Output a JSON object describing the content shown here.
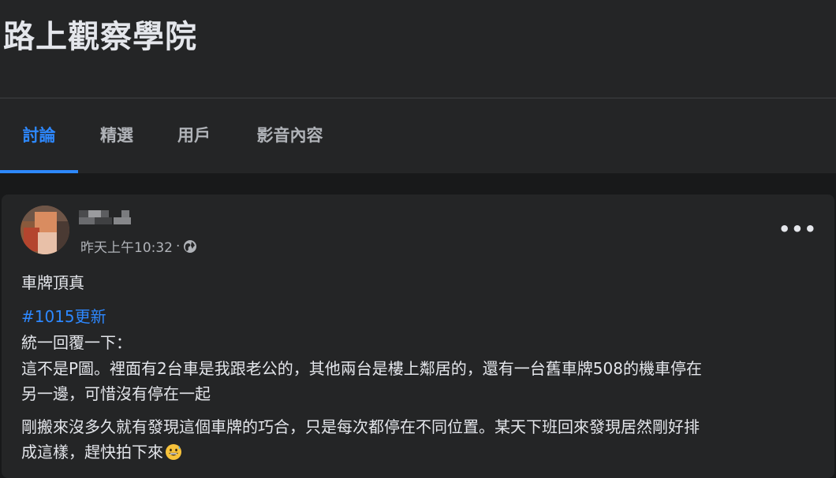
{
  "group": {
    "title": "路上觀察學院"
  },
  "tabs": [
    {
      "label": "討論",
      "active": true
    },
    {
      "label": "精選",
      "active": false
    },
    {
      "label": "用戶",
      "active": false
    },
    {
      "label": "影音內容",
      "active": false
    }
  ],
  "post": {
    "timestamp": "昨天上午10:32",
    "dot": "·",
    "visibility_icon": "globe-icon",
    "more_label": "•••",
    "title": "車牌頂真",
    "hashtag": "#1015更新",
    "body": [
      "統一回覆一下：",
      "這不是P圖。裡面有2台車是我跟老公的，其他兩台是樓上鄰居的，還有一台舊車牌508的機車停在",
      "另一邊，可惜沒有停在一起",
      "剛搬來沒多久就有發現這個車牌的巧合，只是每次都停在不同位置。某天下班回來發現居然剛好排",
      "成這樣，趕快拍下來"
    ],
    "emoji": "grinning-sweat-emoji"
  },
  "colors": {
    "background": "#18191a",
    "surface": "#242526",
    "accent": "#2d88ff",
    "text_primary": "#e4e6eb",
    "text_secondary": "#b0b3b8"
  }
}
